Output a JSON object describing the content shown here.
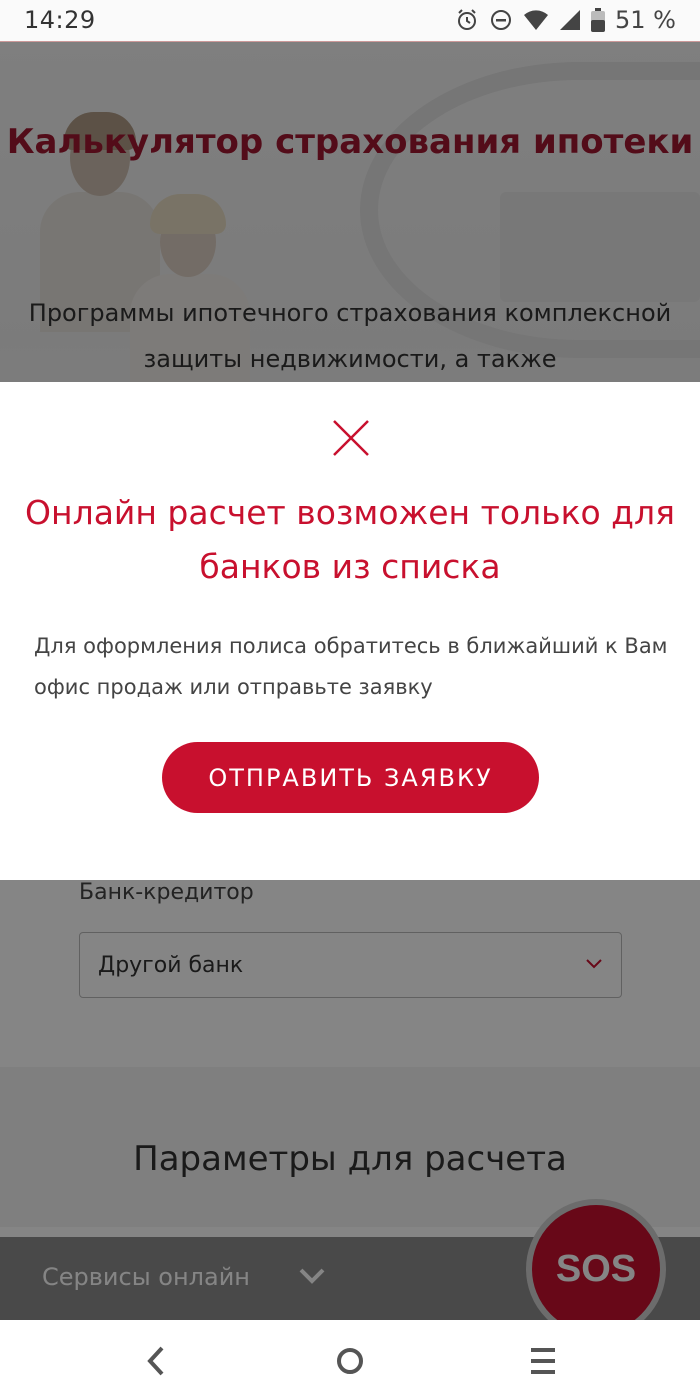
{
  "status_bar": {
    "time": "14:29",
    "battery": "51 %",
    "icons": [
      "alarm-icon",
      "do-not-disturb-icon",
      "wifi-icon",
      "signal-icon",
      "battery-icon"
    ]
  },
  "hero": {
    "title": "Калькулятор страхования ипотеки",
    "text": "Программы ипотечного страхования комплексной защиты недвижимости, а также"
  },
  "modal": {
    "title": "Онлайн расчет возможен только для банков из списка",
    "text": "Для оформления полиса обратитесь в ближайший к Вам офис продаж или отправьте заявку",
    "button_label": "ОТПРАВИТЬ ЗАЯВКУ",
    "close_icon": "close-icon"
  },
  "form": {
    "bank_label": "Банк-кредитор",
    "bank_value": "Другой банк"
  },
  "params": {
    "title": "Параметры для расчета"
  },
  "services_bar": {
    "label": "Сервисы онлайн"
  },
  "sos": {
    "label": "SOS"
  },
  "colors": {
    "accent": "#c8102e",
    "hero_title": "#a01830",
    "dim": "rgba(0,0,0,0.48)"
  },
  "nav": [
    "back-icon",
    "home-icon",
    "recents-icon"
  ]
}
